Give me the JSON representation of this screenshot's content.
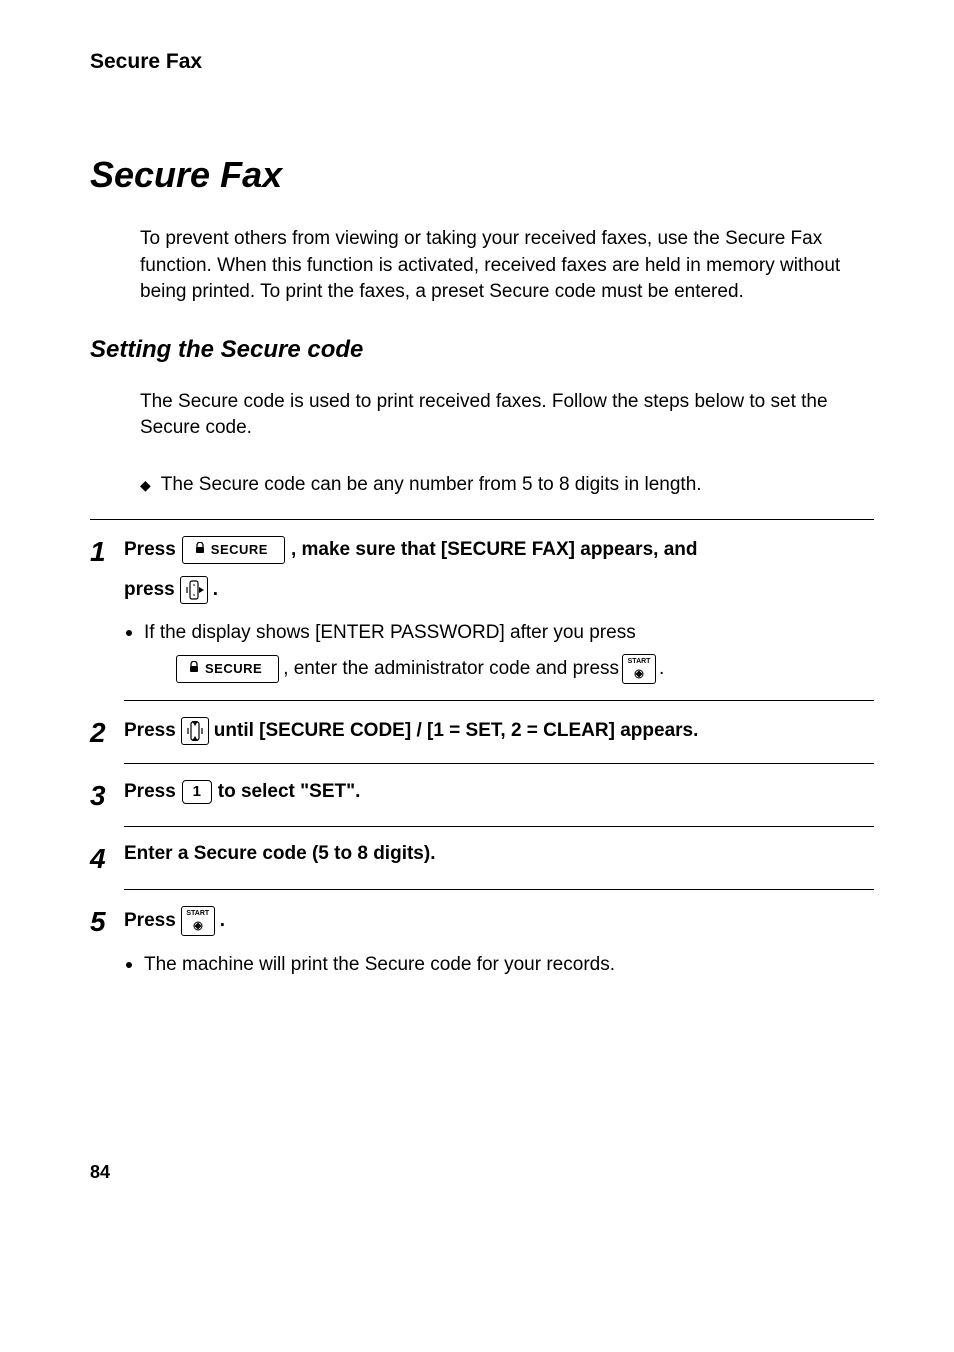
{
  "header": {
    "running": "Secure Fax"
  },
  "title": "Secure Fax",
  "intro": "To prevent others from viewing or taking your received faxes, use the Secure Fax function. When this function is activated, received faxes are held in memory without being printed. To print the faxes, a preset Secure code must be entered.",
  "subheading": "Setting the Secure code",
  "sub_intro": "The Secure code is used to print received faxes. Follow the steps below to set the Secure code.",
  "diamond_bullet": "The Secure code can be any number from 5 to 8 digits in length.",
  "buttons": {
    "secure_label": "SECURE",
    "start_label": "START",
    "digit_one": "1"
  },
  "steps": {
    "s1": {
      "num": "1",
      "t1a": "Press",
      "t1b": ", make sure that [SECURE FAX] appears, and",
      "t2a": "press",
      "t2b": ".",
      "sub_a": "If the display shows [ENTER PASSWORD] after you press",
      "sub_b": ", enter the administrator code and press",
      "sub_c": "."
    },
    "s2": {
      "num": "2",
      "a": "Press",
      "b": "until [SECURE CODE] / [1 = SET, 2 = CLEAR] appears."
    },
    "s3": {
      "num": "3",
      "a": "Press",
      "b": "to select \"SET\"."
    },
    "s4": {
      "num": "4",
      "text": "Enter a Secure code (5 to 8 digits)."
    },
    "s5": {
      "num": "5",
      "a": "Press",
      "b": ".",
      "sub": "The machine will print the Secure code for your records."
    }
  },
  "page_number": "84"
}
